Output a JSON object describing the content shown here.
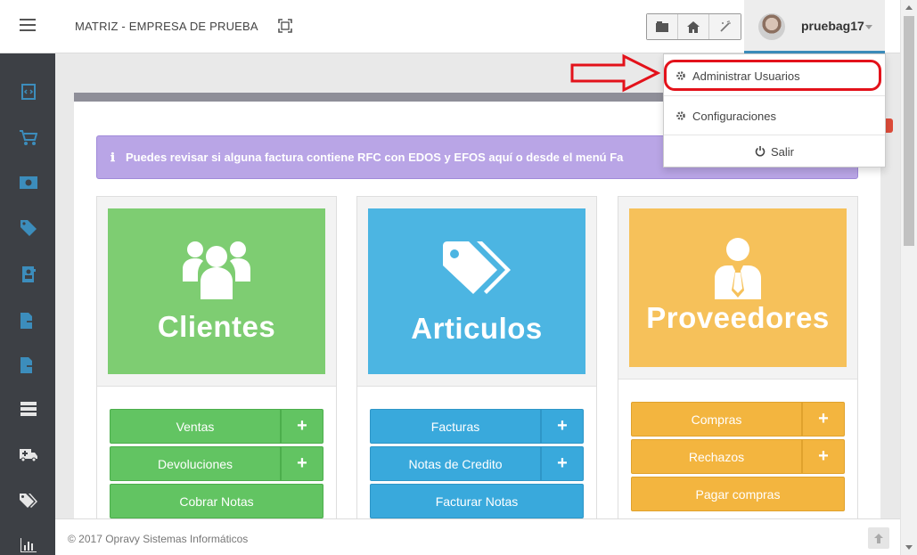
{
  "header": {
    "company_title": "MATRIZ - EMPRESA DE PRUEBA",
    "username": "pruebag17"
  },
  "alert": {
    "icon": "info-icon",
    "message": "Puedes revisar si alguna factura contiene RFC con EDOS y EFOS aquí o desde el menú Fa"
  },
  "user_menu": {
    "items": [
      {
        "label": "Administrar Usuarios",
        "icon": "gear-icon"
      },
      {
        "label": "Configuraciones",
        "icon": "gear-icon"
      }
    ],
    "logout_label": "Salir"
  },
  "cards": {
    "clientes": {
      "title": "Clientes",
      "color": "#7ecd72",
      "buttons": [
        {
          "label": "Ventas",
          "plus": "+"
        },
        {
          "label": "Devoluciones",
          "plus": "+"
        },
        {
          "label": "Cobrar Notas"
        }
      ]
    },
    "articulos": {
      "title": "Articulos",
      "color": "#4cb5e2",
      "buttons": [
        {
          "label": "Facturas",
          "plus": "+"
        },
        {
          "label": "Notas de Credito",
          "plus": "+"
        },
        {
          "label": "Facturar Notas"
        }
      ]
    },
    "proveedores": {
      "title": "Proveedores",
      "color": "#f6c15a",
      "buttons": [
        {
          "label": "Compras",
          "plus": "+"
        },
        {
          "label": "Rechazos",
          "plus": "+"
        },
        {
          "label": "Pagar compras"
        }
      ]
    }
  },
  "footer": {
    "copyright": "© 2017 Opravy Sistemas Informáticos"
  },
  "colors": {
    "sidebar_bg": "#3d4045",
    "sidebar_icon": "#3c8dbc",
    "accent": "#3c8dbc",
    "annotation_red": "#e3121b"
  }
}
